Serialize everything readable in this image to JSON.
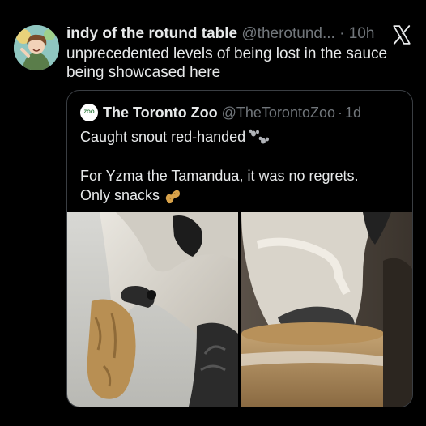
{
  "post": {
    "author_name": "indy of the rotund table",
    "author_handle": "@therotund...",
    "separator": "·",
    "time": "10h",
    "text": "unprecedented levels of being lost in the sauce being showcased here"
  },
  "icons": {
    "close": "x-logo-icon",
    "paw": "paw-prints-icon",
    "peanut": "peanut-icon"
  },
  "quote": {
    "author_name": "The Toronto Zoo",
    "author_handle": "@TheTorontoZoo",
    "separator": "·",
    "time": "1d",
    "avatar_text": "ZOO",
    "line1": "Caught snout red-handed",
    "line2": "For Yzma the Tamandua, it was no regrets.",
    "line3": "Only snacks"
  },
  "colors": {
    "background": "#000000",
    "text": "#e7e9ea",
    "muted": "#71767b",
    "border": "#3a3e43"
  }
}
